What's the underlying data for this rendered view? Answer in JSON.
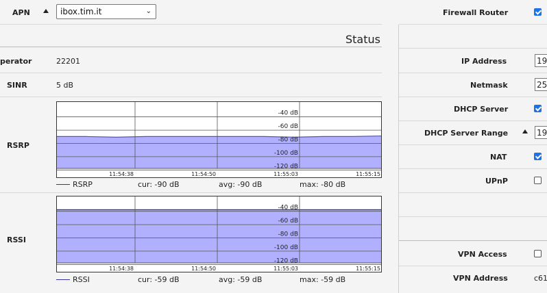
{
  "left": {
    "apn_label": "APN",
    "apn_value": "ibox.tim.it",
    "status_title": "Status",
    "operator_label": "perator",
    "operator_value": "22201",
    "sinr_label": "SINR",
    "sinr_value": "5 dB",
    "rsrp_label": "RSRP",
    "rssi_label": "RSSI"
  },
  "graphs": [
    {
      "id": "rsrp",
      "grid_labels": [
        "-40 dB",
        "-60 dB",
        "-80 dB",
        "-100 dB",
        "-120 dB"
      ],
      "time_labels": [
        "11:54:38",
        "11:54:50",
        "11:55:03",
        "11:55:15"
      ],
      "legend": {
        "name": "RSRP",
        "cur": "cur: -90 dB",
        "avg": "avg: -90 dB",
        "max": "max: -80 dB"
      },
      "values_db": [
        -82,
        -82,
        -83,
        -82,
        -82,
        -82,
        -82,
        -82,
        -83,
        -82,
        -82,
        -81
      ],
      "fill_color": "#b0b0ff",
      "line_color": "#5555aa"
    },
    {
      "id": "rssi",
      "grid_labels": [
        "-40 dB",
        "-60 dB",
        "-80 dB",
        "-100 dB",
        "-120 dB"
      ],
      "time_labels": [
        "11:54:38",
        "11:54:50",
        "11:55:03",
        "11:55:15"
      ],
      "legend": {
        "name": "RSSI",
        "cur": "cur: -59 dB",
        "avg": "avg: -59 dB",
        "max": "max: -59 dB"
      },
      "values_db": [
        -50,
        -50,
        -50,
        -50,
        -50,
        -50,
        -50,
        -50,
        -50,
        -50,
        -50,
        -50
      ],
      "fill_color": "#b0b0ff",
      "line_color": "#333366"
    }
  ],
  "right": {
    "firewall_router_label": "Firewall Router",
    "firewall_router_checked": true,
    "ip_address_label": "IP Address",
    "ip_address_value": "19",
    "netmask_label": "Netmask",
    "netmask_value": "25",
    "dhcp_server_label": "DHCP Server",
    "dhcp_server_checked": true,
    "dhcp_range_label": "DHCP Server Range",
    "dhcp_range_value": "19",
    "nat_label": "NAT",
    "nat_checked": true,
    "upnp_label": "UPnP",
    "upnp_checked": false,
    "vpn_access_label": "VPN Access",
    "vpn_access_checked": false,
    "vpn_address_label": "VPN Address",
    "vpn_address_value": "c61"
  },
  "colors": {
    "accent": "#1a73e8",
    "graph_fill": "#b0b0ff"
  }
}
